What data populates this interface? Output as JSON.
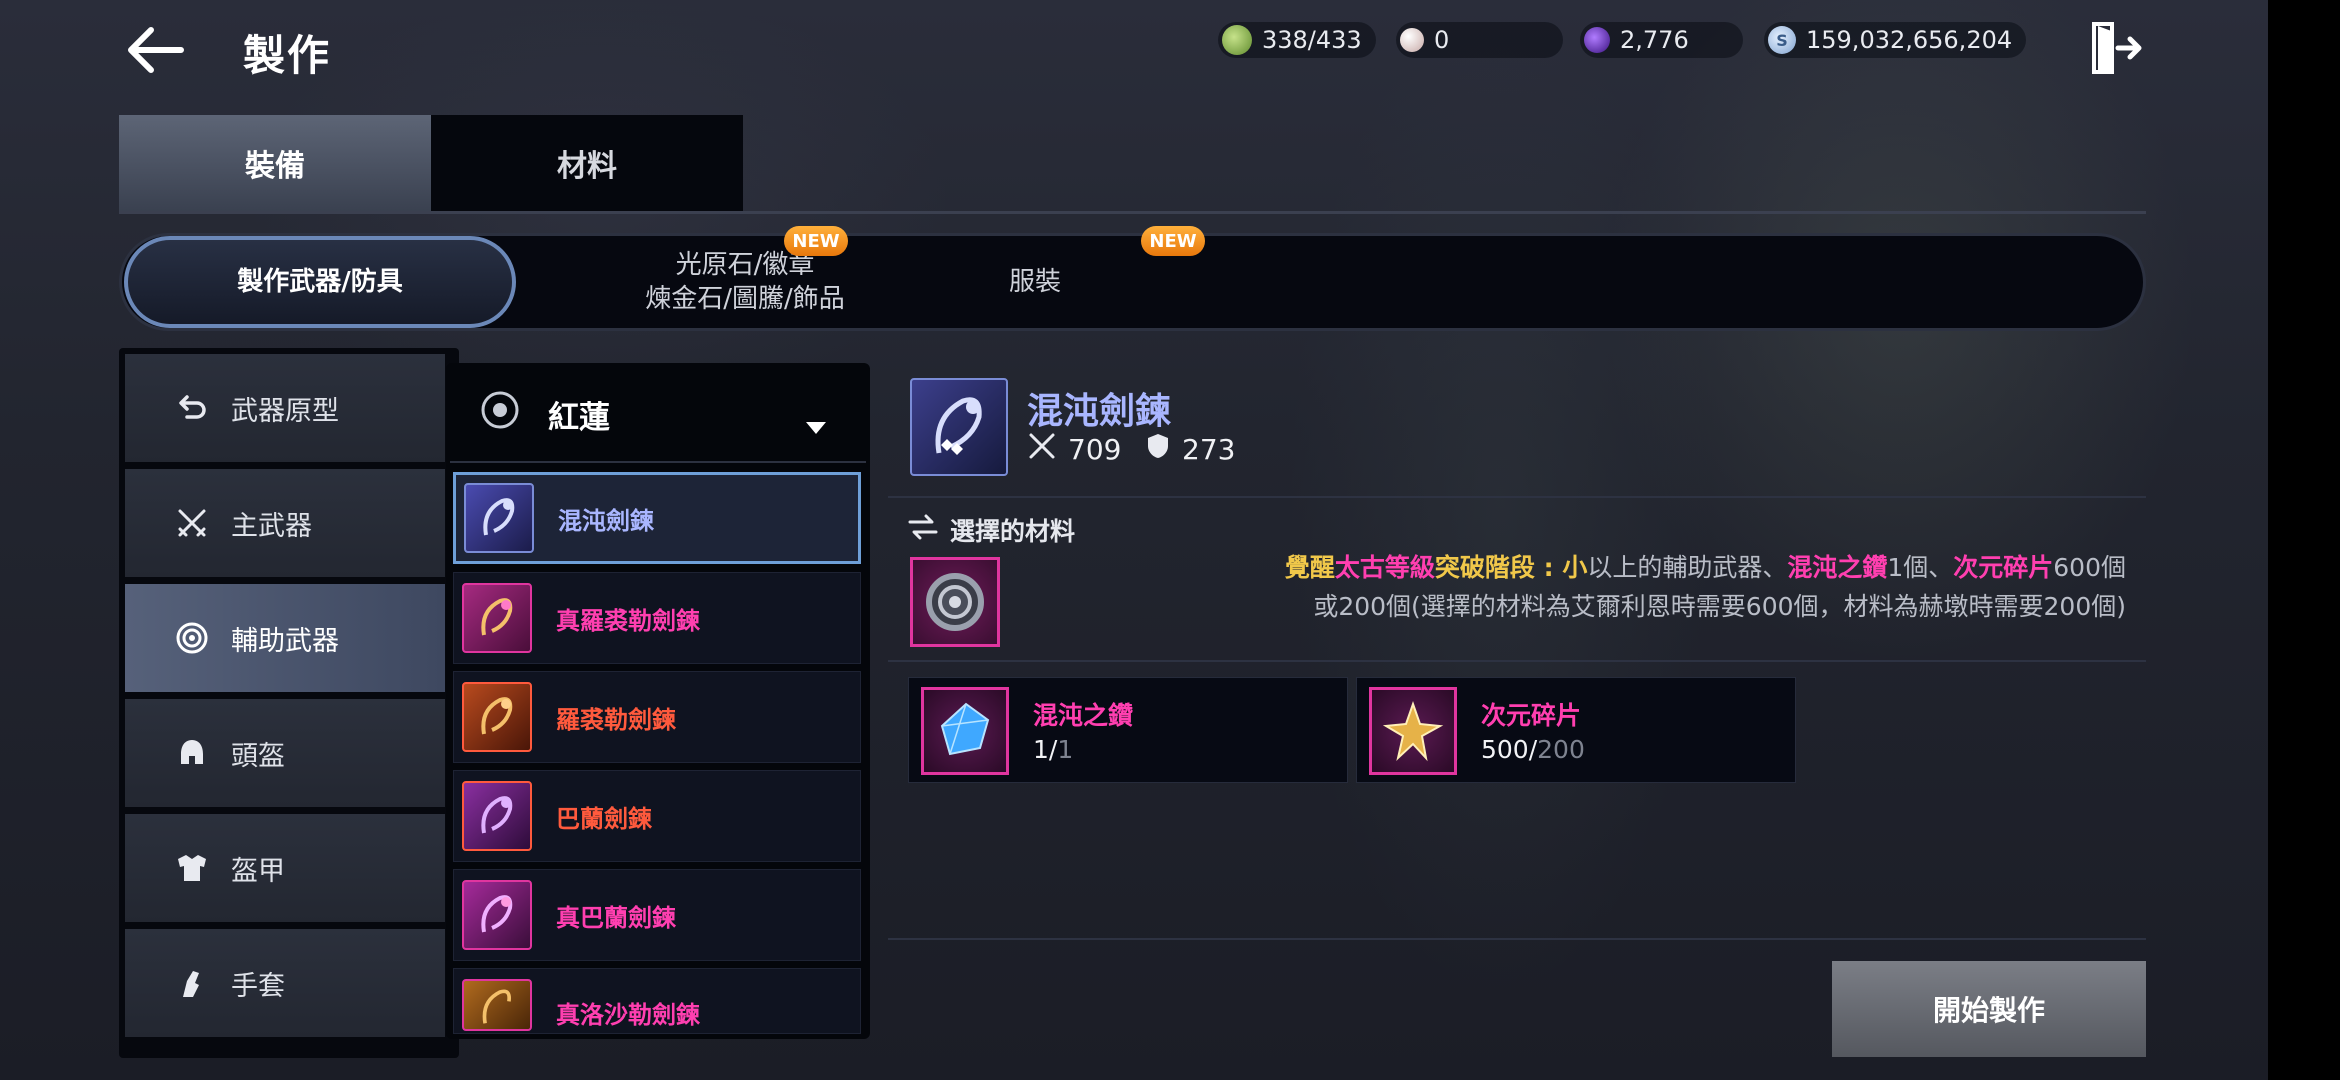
{
  "header": {
    "title": "製作",
    "back_icon": "arrow-left-icon",
    "exit_icon": "exit-door-icon"
  },
  "currencies": [
    {
      "icon": "green-stamina-icon",
      "value": "338/433",
      "color": "#8fbf5a"
    },
    {
      "icon": "pearl-icon",
      "value": "0",
      "color": "#e8d7d2"
    },
    {
      "icon": "purple-orb-icon",
      "value": "2,776",
      "color": "#6a2fc9"
    },
    {
      "icon": "silver-coin-icon",
      "value": "159,032,656,204",
      "color": "#a9c8ee"
    }
  ],
  "main_tabs": [
    {
      "label": "裝備",
      "active": true
    },
    {
      "label": "材料",
      "active": false
    }
  ],
  "sub_tabs": [
    {
      "label": "製作武器/防具",
      "active": true
    },
    {
      "label_line1": "光原石/徽章",
      "label_line2": "煉金石/圖騰/飾品",
      "badge": "NEW"
    },
    {
      "label": "服裝",
      "badge": "NEW"
    }
  ],
  "categories": [
    {
      "label": "武器原型",
      "icon": "return-arrow-icon"
    },
    {
      "label": "主武器",
      "icon": "crossed-swords-icon"
    },
    {
      "label": "輔助武器",
      "icon": "ring-target-icon",
      "active": true
    },
    {
      "label": "頭盔",
      "icon": "helmet-icon"
    },
    {
      "label": "盔甲",
      "icon": "armor-icon"
    },
    {
      "label": "手套",
      "icon": "glove-icon"
    }
  ],
  "dropdown": {
    "label": "紅蓮",
    "icon": "circle-dot-icon",
    "arrow": "caret-down-icon"
  },
  "items": [
    {
      "name": "混沌劍鍊",
      "color": "#a9b6ff",
      "icon_color": "#3f3f95"
    },
    {
      "name": "真羅裘勒劍鍊",
      "color": "#ff3fb0",
      "icon_color": "#8a1f6a"
    },
    {
      "name": "羅裘勒劍鍊",
      "color": "#ff5a3d",
      "icon_color": "#8a2f18"
    },
    {
      "name": "巴蘭劍鍊",
      "color": "#ff5a3d",
      "icon_color": "#6a1f6a"
    },
    {
      "name": "真巴蘭劍鍊",
      "color": "#ff3fb0",
      "icon_color": "#8a1f6a"
    },
    {
      "name": "真洛沙勒劍鍊",
      "color": "#ff3fb0",
      "icon_color": "#8a4a18"
    }
  ],
  "detail": {
    "name": "混沌劍鍊",
    "attack": "709",
    "defense": "273",
    "attack_icon": "crossed-swords-icon",
    "defense_icon": "shield-icon",
    "selected_materials_title": "選擇的材料",
    "materials_icon": "swap-arrows-icon",
    "req_line1": {
      "a": "覺醒",
      "b": "太古等級",
      "c": "突破階段",
      "d": " : 小",
      "e": "以上的輔助武器、",
      "f": "混沌之鑽",
      "g": "1個、",
      "h": "次元碎片",
      "i": "600個"
    },
    "req_line2": "或200個(選擇的材料為艾爾利恩時需要600個，材料為赫墩時需要200個)",
    "materials": [
      {
        "name": "混沌之鑽",
        "have": "1/",
        "need": "1",
        "icon": "blue-crystal-icon"
      },
      {
        "name": "次元碎片",
        "have": "500/",
        "need": "200",
        "icon": "gold-shard-icon"
      }
    ],
    "start_button": "開始製作"
  }
}
